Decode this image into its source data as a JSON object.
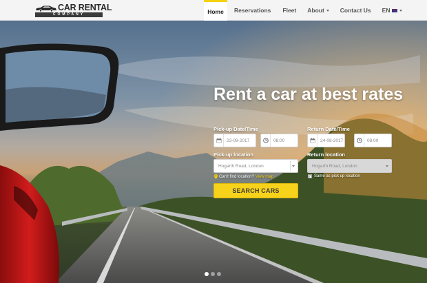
{
  "brand": {
    "title": "CAR RENTAL",
    "subtitle": "COMPANY"
  },
  "nav": {
    "items": [
      {
        "label": "Home",
        "active": true
      },
      {
        "label": "Reservations"
      },
      {
        "label": "Fleet"
      },
      {
        "label": "About"
      },
      {
        "label": "Contact Us"
      }
    ],
    "language": "EN"
  },
  "hero": {
    "headline": "Rent a car at best rates",
    "slides_count": 3,
    "active_slide": 1
  },
  "form": {
    "pickup_datetime_label": "Pick-up Date/Time",
    "pickup_date": "23-08-2017",
    "pickup_time": "08:00",
    "return_datetime_label": "Return Date/Time",
    "return_date": "24-08-2017",
    "return_time": "08:00",
    "pickup_location_label": "Pick-up location",
    "pickup_location": "Hogarth Road, London",
    "return_location_label": "Return location",
    "return_location": "Hogarth Road, London",
    "cant_find_text": "Can't find location?",
    "view_map_text": "View map",
    "same_as_pickup_text": "Same as pick up location",
    "same_as_pickup_checked": true,
    "search_label": "SEARCH CARS"
  },
  "colors": {
    "accent": "#f5d20f",
    "button": "#f7d21b"
  }
}
